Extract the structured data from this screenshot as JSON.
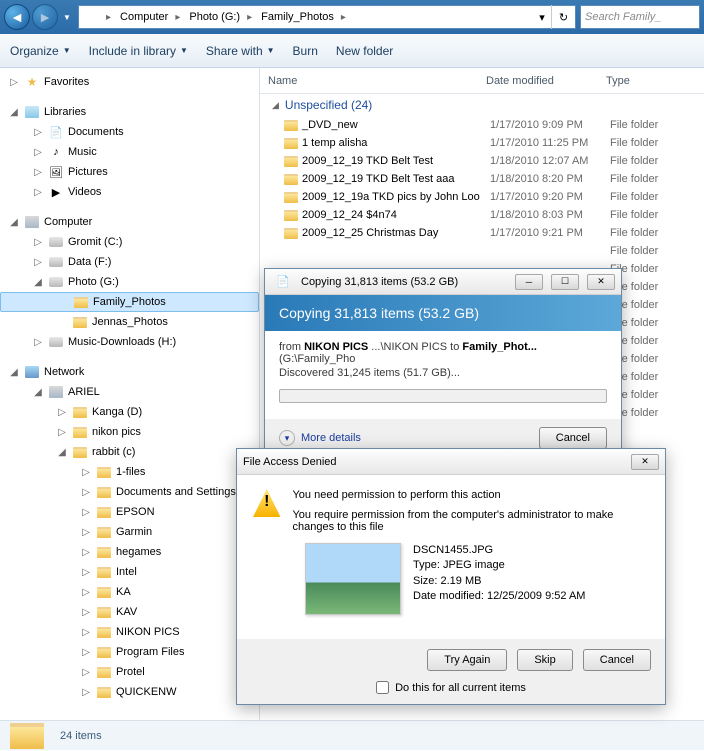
{
  "nav": {
    "breadcrumb": [
      "Computer",
      "Photo (G:)",
      "Family_Photos"
    ],
    "search_placeholder": "Search Family_"
  },
  "toolbar": {
    "organize": "Organize",
    "include": "Include in library",
    "share": "Share with",
    "burn": "Burn",
    "newfolder": "New folder"
  },
  "sidebar": {
    "favorites": "Favorites",
    "libraries": "Libraries",
    "lib_items": [
      "Documents",
      "Music",
      "Pictures",
      "Videos"
    ],
    "computer": "Computer",
    "drives": [
      "Gromit (C:)",
      "Data (F:)",
      "Photo (G:)"
    ],
    "photo_children": [
      "Family_Photos",
      "Jennas_Photos"
    ],
    "music_dl": "Music-Downloads (H:)",
    "network": "Network",
    "ariel": "ARIEL",
    "ariel_children": [
      "Kanga (D)",
      "nikon pics",
      "rabbit (c)"
    ],
    "rabbit_children": [
      "1-files",
      "Documents and Settings",
      "EPSON",
      "Garmin",
      "hegames",
      "Intel",
      "KA",
      "KAV",
      "NIKON PICS",
      "Program Files",
      "Protel",
      "QUICKENW"
    ]
  },
  "content": {
    "cols": {
      "name": "Name",
      "date": "Date modified",
      "type": "Type"
    },
    "group": "Unspecified (24)",
    "rows": [
      {
        "name": "_DVD_new",
        "date": "1/17/2010 9:09 PM",
        "type": "File folder"
      },
      {
        "name": "1 temp alisha",
        "date": "1/17/2010 11:25 PM",
        "type": "File folder"
      },
      {
        "name": "2009_12_19 TKD Belt Test",
        "date": "1/18/2010 12:07 AM",
        "type": "File folder"
      },
      {
        "name": "2009_12_19 TKD Belt Test aaa",
        "date": "1/18/2010 8:20 PM",
        "type": "File folder"
      },
      {
        "name": "2009_12_19a TKD pics by John Loo",
        "date": "1/17/2010 9:20 PM",
        "type": "File folder"
      },
      {
        "name": "2009_12_24 $4n74",
        "date": "1/18/2010 8:03 PM",
        "type": "File folder"
      },
      {
        "name": "2009_12_25 Christmas Day",
        "date": "1/17/2010 9:21 PM",
        "type": "File folder"
      }
    ],
    "hidden_types": [
      "File folder",
      "File folder",
      "File folder",
      "File folder",
      "File folder",
      "File folder",
      "File folder",
      "File folder",
      "File folder",
      "File folder"
    ]
  },
  "status": {
    "count": "24 items"
  },
  "copy": {
    "title": "Copying 31,813 items (53.2 GB)",
    "heading": "Copying 31,813 items (53.2 GB)",
    "from_lbl": "from ",
    "from_bold": "NIKON PICS",
    "from_mid": " ...\\NIKON PICS to ",
    "to_bold": "Family_Phot...",
    "to_tail": " (G:\\Family_Pho",
    "discovered": "Discovered 31,245 items (51.7 GB)...",
    "more": "More details",
    "cancel": "Cancel"
  },
  "deny": {
    "title": "File Access Denied",
    "line1": "You need permission to perform this action",
    "line2": "You require permission from the computer's administrator to make changes to this file",
    "fname": "DSCN1455.JPG",
    "ftype": "Type: JPEG image",
    "fsize": "Size: 2.19 MB",
    "fdate": "Date modified: 12/25/2009 9:52 AM",
    "try": "Try Again",
    "skip": "Skip",
    "cancel": "Cancel",
    "doall": "Do this for all current items"
  }
}
